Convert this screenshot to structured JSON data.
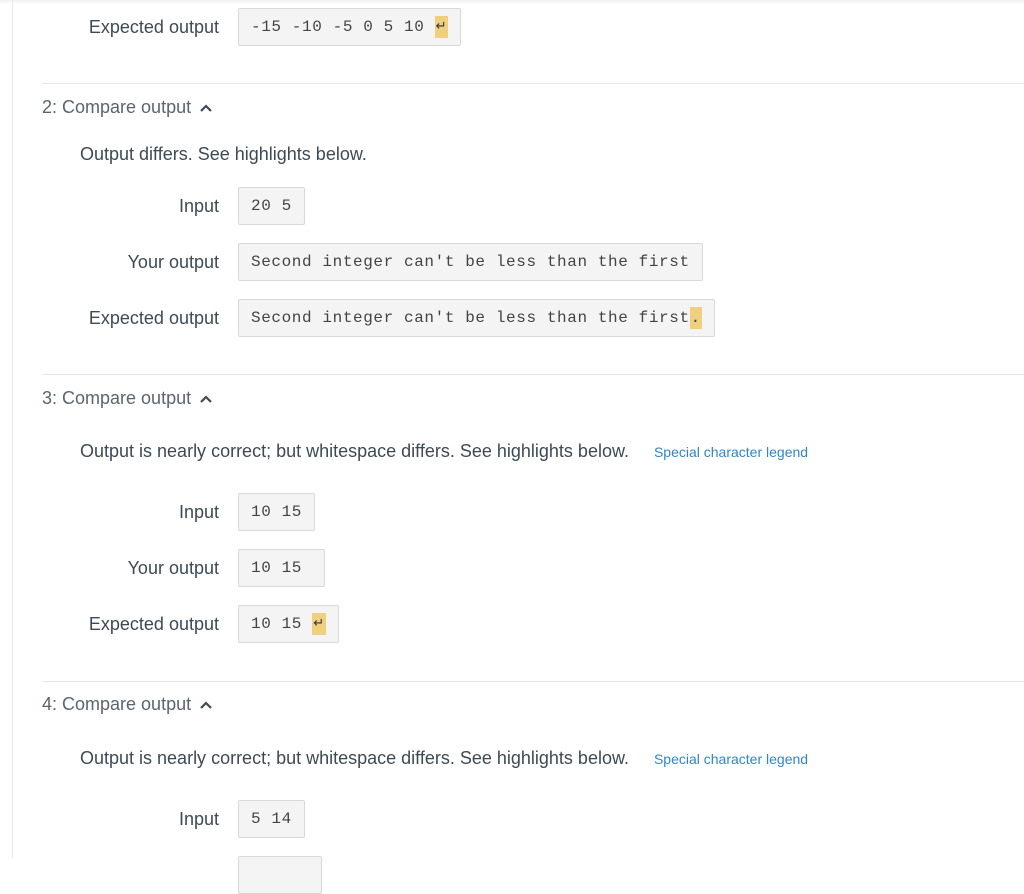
{
  "colors": {
    "highlight": "#f0d07e",
    "link": "#2f86c9",
    "text": "#3d4a55",
    "code_bg": "#f4f4f4"
  },
  "top_partial": {
    "expected_label": "Expected output",
    "expected_value": "-15 -10 -5 0 5 10 ",
    "expected_highlight": "↵"
  },
  "tests": [
    {
      "header": "2: Compare output",
      "icon": "chevron-up-icon",
      "message": "Output differs. See highlights below.",
      "legend_link": null,
      "input_label": "Input",
      "input_value": "20 5",
      "your_label": "Your output",
      "your_value": "Second integer can't be less than the first",
      "expected_label": "Expected output",
      "expected_value": "Second integer can't be less than the first",
      "expected_highlight": "."
    },
    {
      "header": "3: Compare output",
      "icon": "chevron-up-icon",
      "message": "Output is nearly correct; but whitespace differs. See highlights below.",
      "legend_link": "Special character legend",
      "input_label": "Input",
      "input_value": "10 15",
      "your_label": "Your output",
      "your_value": "10 15 ",
      "expected_label": "Expected output",
      "expected_value": "10 15 ",
      "expected_highlight": "↵"
    },
    {
      "header": "4: Compare output",
      "icon": "chevron-up-icon",
      "message": "Output is nearly correct; but whitespace differs. See highlights below.",
      "legend_link": "Special character legend",
      "input_label": "Input",
      "input_value": "5 14"
    }
  ]
}
